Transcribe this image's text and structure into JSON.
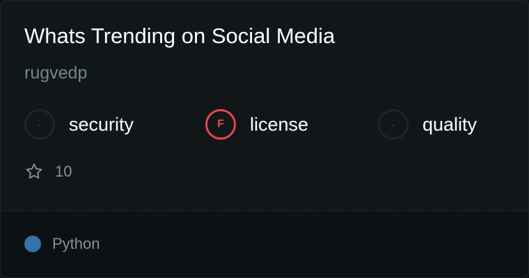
{
  "repo": {
    "title": "Whats Trending on Social Media",
    "owner": "rugvedp"
  },
  "metrics": [
    {
      "grade": "-",
      "label": "security",
      "status": "none"
    },
    {
      "grade": "F",
      "label": "license",
      "status": "fail"
    },
    {
      "grade": "-",
      "label": "quality",
      "status": "none"
    }
  ],
  "stars": {
    "icon": "star-outline-icon",
    "count": "10"
  },
  "language": {
    "name": "Python",
    "color": "#3572A5"
  },
  "colors": {
    "background": "#111719",
    "title": "#ffffff",
    "owner": "#6d8a83",
    "grade_fail": "#e5484d",
    "muted_text": "#8a9295"
  }
}
